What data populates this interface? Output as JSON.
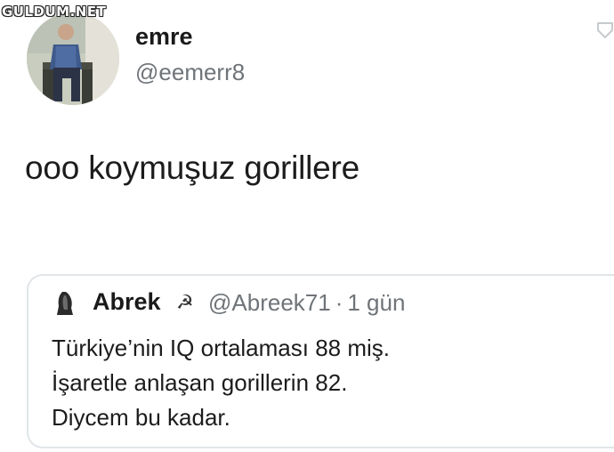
{
  "watermark": "GULDUM.NET",
  "tweet": {
    "author": {
      "display_name": "emre",
      "handle": "@eemerr8"
    },
    "text": "ooo koymuşuz gorillere",
    "quoted": {
      "author": {
        "display_name": "Abrek",
        "name_emoji": "☭",
        "handle": "@Abreek71",
        "separator": "·",
        "time": "1 gün"
      },
      "lines": [
        "Türkiye’nin IQ ortalaması 88 miş.",
        "İşaretle anlaşan gorillerin 82.",
        "Diycem bu kadar."
      ]
    }
  },
  "colors": {
    "text": "#1c1c1c",
    "secondary_text": "#6f7479",
    "card_border": "#e1e5e8"
  },
  "icons": {
    "avatar": "user-photo-avatar",
    "quote_avatar": "user-photo-avatar-small",
    "menu": "chevron-down-icon"
  }
}
